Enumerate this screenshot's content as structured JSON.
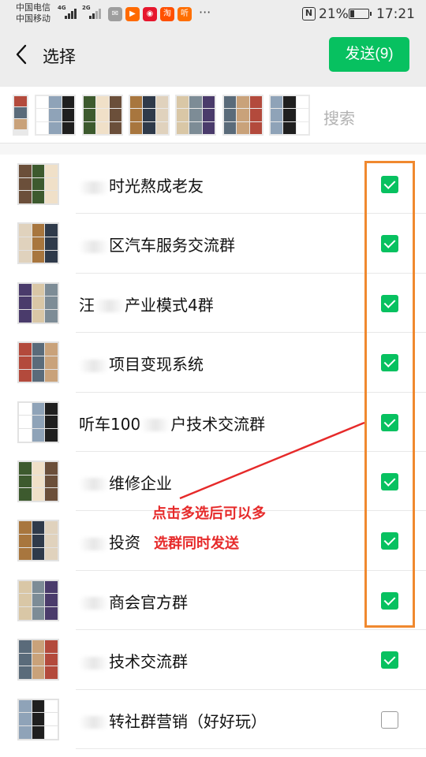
{
  "status_bar": {
    "carrier_1": "中国电信",
    "carrier_2": "中国移动",
    "net_1": "4G",
    "net_2": "2G",
    "dots": "···",
    "nfc": "N",
    "battery": "21%",
    "time": "17:21",
    "app_icons": [
      {
        "name": "wechat-icon",
        "color": "#9e9e9e",
        "glyph": "✉"
      },
      {
        "name": "video-app-icon",
        "color": "#ff6a00",
        "glyph": "▶"
      },
      {
        "name": "weibo-icon",
        "color": "#e6162d",
        "glyph": "◉"
      },
      {
        "name": "taobao-icon",
        "color": "#ff5000",
        "glyph": "淘"
      },
      {
        "name": "listen-app-icon",
        "color": "#ff6f00",
        "glyph": "听"
      }
    ]
  },
  "header": {
    "title": "选择",
    "send_label": "发送(9)"
  },
  "search": {
    "placeholder": "搜索"
  },
  "list": [
    {
      "name_start": "",
      "name_end": "时光熬成老友",
      "checked": true
    },
    {
      "name_start": "",
      "name_end": "区汽车服务交流群",
      "checked": true
    },
    {
      "name_start": "汪",
      "name_end": "产业模式4群",
      "checked": true
    },
    {
      "name_start": "",
      "name_end": "项目变现系统",
      "checked": true
    },
    {
      "name_start": "听车100",
      "name_end": "户技术交流群",
      "checked": true
    },
    {
      "name_start": "",
      "name_end": "维修企业",
      "checked": true
    },
    {
      "name_start": "",
      "name_end": "投资",
      "checked": true
    },
    {
      "name_start": "",
      "name_end": "商会官方群",
      "checked": true
    },
    {
      "name_start": "",
      "name_end": "技术交流群",
      "checked": true
    },
    {
      "name_start": "",
      "name_end": "转社群营销（好好玩）",
      "checked": false
    }
  ],
  "annotation": {
    "line_1": "点击多选后可以多",
    "line_2": "选群同时发送",
    "color": "#e62a2a",
    "box_color": "#f0892f"
  },
  "colors": {
    "accent": "#07c160",
    "header_bg": "#ededed"
  }
}
